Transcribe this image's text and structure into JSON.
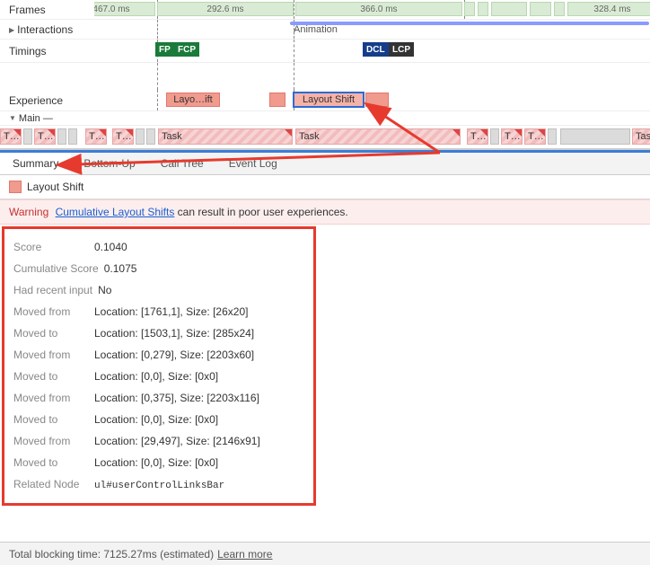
{
  "rows": {
    "frames": "Frames",
    "interactions": "Interactions",
    "timings": "Timings",
    "experience": "Experience",
    "main": "Main"
  },
  "frames": {
    "f1": "467.0 ms",
    "f2": "292.6 ms",
    "f3": "366.0 ms",
    "f4": "328.4 ms"
  },
  "interactions": {
    "label": "Animation"
  },
  "timings": {
    "fp": "FP",
    "fcp": "FCP",
    "dcl": "DCL",
    "lcp": "LCP"
  },
  "experience": {
    "block1": "Layo…ift",
    "block2": "Layout Shift"
  },
  "mainTasks": {
    "tshort": "T…",
    "task": "Task"
  },
  "tabs": {
    "summary": "Summary",
    "bottomup": "Bottom-Up",
    "calltree": "Call Tree",
    "eventlog": "Event Log"
  },
  "header": {
    "title": "Layout Shift"
  },
  "warning": {
    "label": "Warning",
    "link": "Cumulative Layout Shifts",
    "rest": " can result in poor user experiences."
  },
  "details": [
    {
      "k": "Score",
      "v": "0.1040"
    },
    {
      "k": "Cumulative Score",
      "v": "0.1075"
    },
    {
      "k": "Had recent input",
      "v": "No"
    },
    {
      "k": "Moved from",
      "v": "Location: [1761,1], Size: [26x20]"
    },
    {
      "k": "Moved to",
      "v": "Location: [1503,1], Size: [285x24]"
    },
    {
      "k": "Moved from",
      "v": "Location: [0,279], Size: [2203x60]"
    },
    {
      "k": "Moved to",
      "v": "Location: [0,0], Size: [0x0]"
    },
    {
      "k": "Moved from",
      "v": "Location: [0,375], Size: [2203x116]"
    },
    {
      "k": "Moved to",
      "v": "Location: [0,0], Size: [0x0]"
    },
    {
      "k": "Moved from",
      "v": "Location: [29,497], Size: [2146x91]"
    },
    {
      "k": "Moved to",
      "v": "Location: [0,0], Size: [0x0]"
    }
  ],
  "relatedNode": {
    "k": "Related Node",
    "v": "ul#userControlLinksBar"
  },
  "footer": {
    "text": "Total blocking time: 7125.27ms (estimated)",
    "link": "Learn more"
  }
}
